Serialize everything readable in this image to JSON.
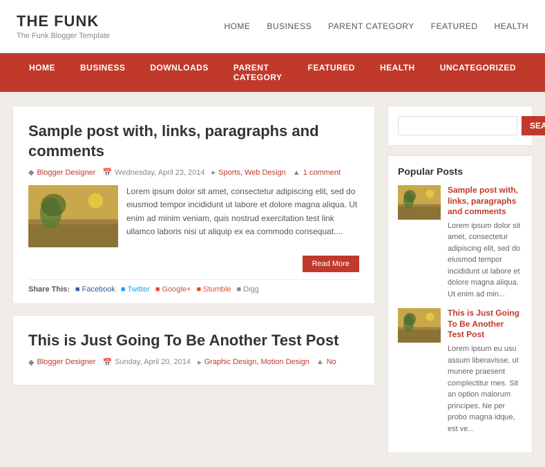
{
  "header": {
    "site_title": "THE FUNK",
    "site_subtitle": "The Funk Blogger Template",
    "top_nav": [
      {
        "label": "HOME"
      },
      {
        "label": "BUSINESS"
      },
      {
        "label": "PARENT CATEGORY"
      },
      {
        "label": "FEATURED"
      },
      {
        "label": "HEALTH"
      }
    ]
  },
  "main_nav": [
    {
      "label": "HOME"
    },
    {
      "label": "BUSINESS"
    },
    {
      "label": "DOWNLOADS"
    },
    {
      "label": "PARENT CATEGORY"
    },
    {
      "label": "FEATURED"
    },
    {
      "label": "HEALTH"
    },
    {
      "label": "UNCATEGORIZED"
    }
  ],
  "posts": [
    {
      "title": "Sample post with, links, paragraphs and comments",
      "author": "Blogger Designer",
      "date": "Wednesday, April 23, 2014",
      "tags": "Sports, Web Design",
      "comments": "1 comment",
      "excerpt": "Lorem ipsum dolor sit amet, consectetur adipiscing elit, sed do eiusmod tempor incididunt ut labore et dolore magna aliqua. Ut enim ad minim veniam, quis nostrud exercitation test link ullamco laboris nisi ut aliquip ex ea commodo consequat....",
      "read_more": "Read More",
      "share_label": "Share This:",
      "share_buttons": [
        {
          "label": "Facebook",
          "type": "fb"
        },
        {
          "label": "Twitter",
          "type": "tw"
        },
        {
          "label": "Google+",
          "type": "gp"
        },
        {
          "label": "Stumble",
          "type": "st"
        },
        {
          "label": "Digg",
          "type": "di"
        }
      ]
    },
    {
      "title": "This is Just Going To Be Another Test Post",
      "author": "Blogger Designer",
      "date": "Sunday, April 20, 2014",
      "tags": "Graphic Design, Motion Design",
      "comments": "No",
      "excerpt": "",
      "read_more": "",
      "share_label": "",
      "share_buttons": []
    }
  ],
  "sidebar": {
    "search_placeholder": "",
    "search_button": "SEARCH",
    "popular_posts_title": "Popular Posts",
    "popular_posts": [
      {
        "title": "Sample post with, links, paragraphs and comments",
        "excerpt": "Lorem ipsum dolor sit amet, consectetur adipiscing elit, sed do eiusmod tempor incididunt ut labore et dolore magna aliqua. Ut enim ad min..."
      },
      {
        "title": "This is Just Going To Be Another Test Post",
        "excerpt": "Lorem ipsum eu usu assum liberavisse, ut munere praesent complectitur mes. Sit an option malorum principes. Ne per probo magna idque, est ve..."
      }
    ]
  }
}
